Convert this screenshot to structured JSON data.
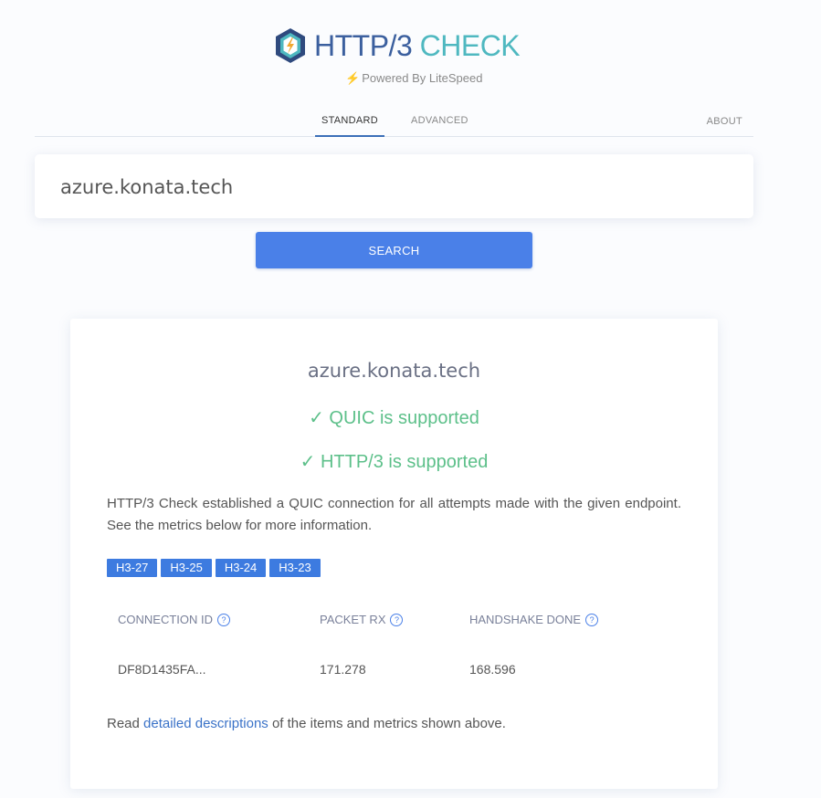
{
  "brand": {
    "title_a": "HTTP/3",
    "title_b": "CHECK",
    "powered": "Powered By LiteSpeed",
    "colors": {
      "primary": "#3b5f9e",
      "accent": "#4fb8c0",
      "bolt": "#f0a830"
    }
  },
  "nav": {
    "tabs": [
      {
        "label": "STANDARD",
        "active": true
      },
      {
        "label": "ADVANCED",
        "active": false
      }
    ],
    "about": "ABOUT"
  },
  "search": {
    "value": "azure.konata.tech",
    "button": "SEARCH"
  },
  "result": {
    "domain": "azure.konata.tech",
    "quic": "✓ QUIC is supported",
    "http3": "✓ HTTP/3 is supported",
    "description": "HTTP/3 Check established a QUIC connection for all attempts made with the given endpoint. See the metrics below for more information.",
    "versions": [
      "H3-27",
      "H3-25",
      "H3-24",
      "H3-23"
    ],
    "columns": [
      "CONNECTION ID",
      "PACKET RX",
      "HANDSHAKE DONE"
    ],
    "values": [
      "DF8D1435FA...",
      "171.278",
      "168.596"
    ],
    "read_prefix": "Read ",
    "read_link": "detailed descriptions",
    "read_suffix": " of the items and metrics shown above.",
    "colors": {
      "success": "#5dc08a",
      "badge": "#3d7be0",
      "link": "#3b73c8"
    }
  },
  "icons": [
    "litespeed-logo-icon",
    "bolt-icon",
    "help-icon"
  ]
}
